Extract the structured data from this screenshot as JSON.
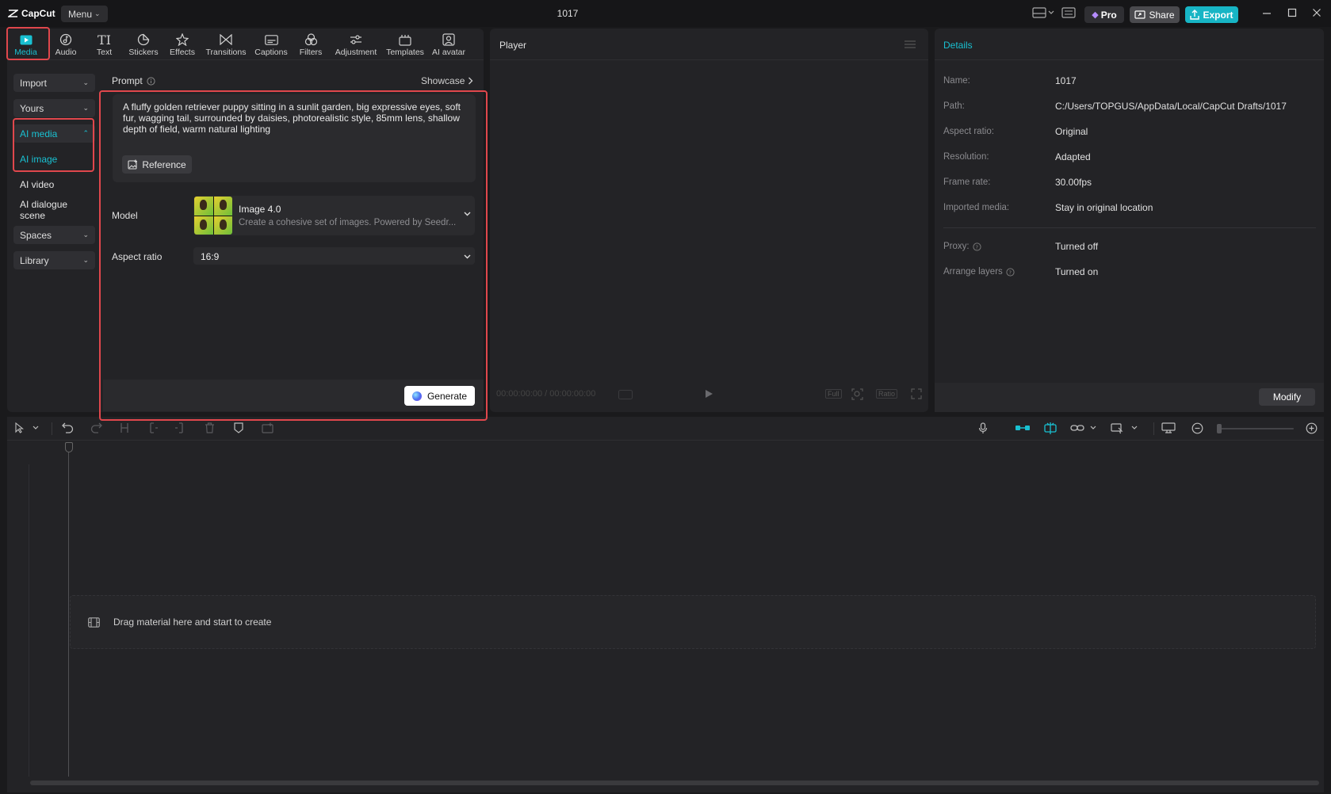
{
  "app": {
    "logo_text": "CapCut",
    "menu_label": "Menu",
    "window_title": "1017"
  },
  "titlebar": {
    "pro_label": "Pro",
    "share_label": "Share",
    "export_label": "Export"
  },
  "tabs": [
    {
      "label": "Media",
      "icon": "media-icon",
      "active": true
    },
    {
      "label": "Audio",
      "icon": "audio-icon"
    },
    {
      "label": "Text",
      "icon": "text-icon"
    },
    {
      "label": "Stickers",
      "icon": "stickers-icon"
    },
    {
      "label": "Effects",
      "icon": "effects-icon"
    },
    {
      "label": "Transitions",
      "icon": "transitions-icon"
    },
    {
      "label": "Captions",
      "icon": "captions-icon"
    },
    {
      "label": "Filters",
      "icon": "filters-icon"
    },
    {
      "label": "Adjustment",
      "icon": "adjustment-icon"
    },
    {
      "label": "Templates",
      "icon": "templates-icon"
    },
    {
      "label": "AI avatar",
      "icon": "ai-avatar-icon"
    }
  ],
  "sidebar": {
    "items": [
      {
        "label": "Import"
      },
      {
        "label": "Yours"
      },
      {
        "label": "AI media"
      },
      {
        "label": "AI image"
      },
      {
        "label": "AI video"
      },
      {
        "label": "AI dialogue scene"
      },
      {
        "label": "Spaces"
      },
      {
        "label": "Library"
      }
    ]
  },
  "ai_image": {
    "prompt_label": "Prompt",
    "showcase_label": "Showcase",
    "prompt_text": "A fluffy golden retriever puppy sitting in a sunlit garden, big expressive eyes, soft fur, wagging tail, surrounded by daisies, photorealistic style, 85mm lens, shallow depth of field, warm natural lighting",
    "reference_label": "Reference",
    "model_label": "Model",
    "model_name": "Image 4.0",
    "model_desc": "Create a cohesive set of images. Powered by Seedr...",
    "aspect_label": "Aspect ratio",
    "aspect_value": "16:9",
    "generate_label": "Generate"
  },
  "player": {
    "title": "Player",
    "timecode": "00:00:00:00 / 00:00:00:00",
    "full_label": "Full",
    "ratio_label": "Ratio"
  },
  "details": {
    "title": "Details",
    "rows": [
      {
        "key": "Name:",
        "value": "1017"
      },
      {
        "key": "Path:",
        "value": "C:/Users/TOPGUS/AppData/Local/CapCut Drafts/1017"
      },
      {
        "key": "Aspect ratio:",
        "value": "Original"
      },
      {
        "key": "Resolution:",
        "value": "Adapted"
      },
      {
        "key": "Frame rate:",
        "value": "30.00fps"
      },
      {
        "key": "Imported media:",
        "value": "Stay in original location"
      }
    ],
    "rows2": [
      {
        "key": "Proxy:",
        "value": "Turned off"
      },
      {
        "key": "Arrange layers",
        "value": "Turned on"
      }
    ],
    "modify_label": "Modify"
  },
  "timeline": {
    "drop_text": "Drag material here and start to create"
  },
  "colors": {
    "accent": "#19c0d1",
    "highlight": "#e0474c",
    "panel": "#232326",
    "background": "#1a1a1c"
  }
}
